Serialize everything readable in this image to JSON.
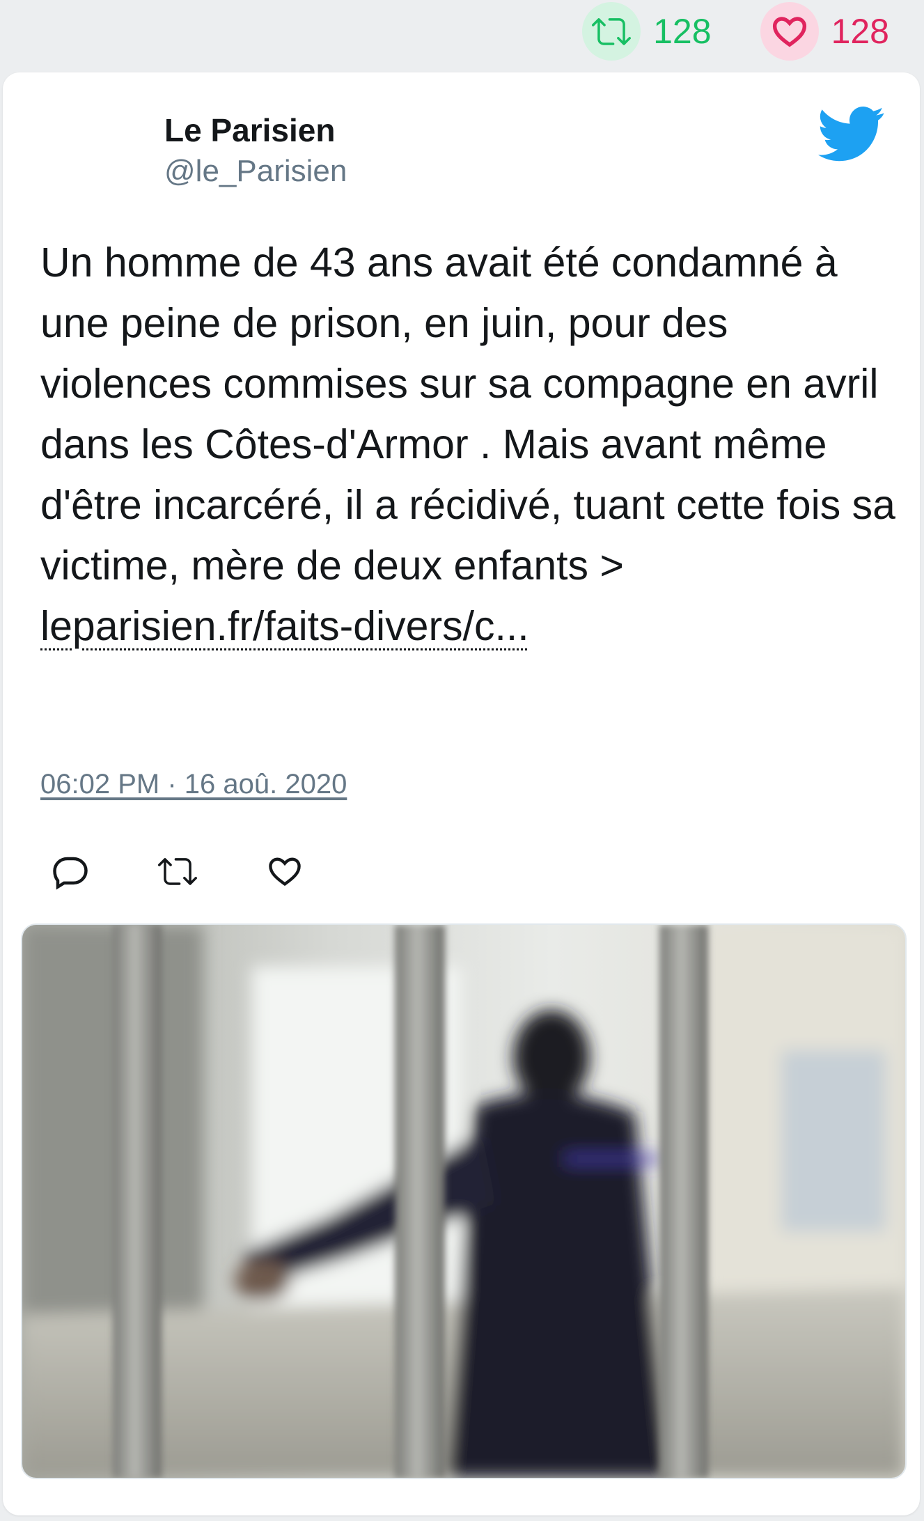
{
  "top_stats": {
    "retweet_count": "128",
    "like_count": "128"
  },
  "tweet": {
    "author_name": "Le Parisien",
    "author_handle": "@le_Parisien",
    "text": "Un homme de 43 ans avait été condamné à une peine de prison, en juin, pour des violences commises sur sa compagne en avril dans les Côtes-d'Armor . Mais avant même d'être incarcéré, il a récidivé, tuant cette fois sa victime, mère de deux enfants > ",
    "link_text": "leparisien.fr/faits-divers/c...",
    "timestamp": "06:02 PM · 16 aoû. 2020"
  },
  "colors": {
    "retweet_green": "#17bf63",
    "like_red": "#e0245e",
    "twitter_blue": "#1da1f2",
    "text_dark": "#14171a",
    "text_muted": "#657786"
  },
  "icons": {
    "retweet": "retweet-icon",
    "like": "heart-icon",
    "brand": "twitter-bird-icon",
    "reply": "reply-icon"
  }
}
